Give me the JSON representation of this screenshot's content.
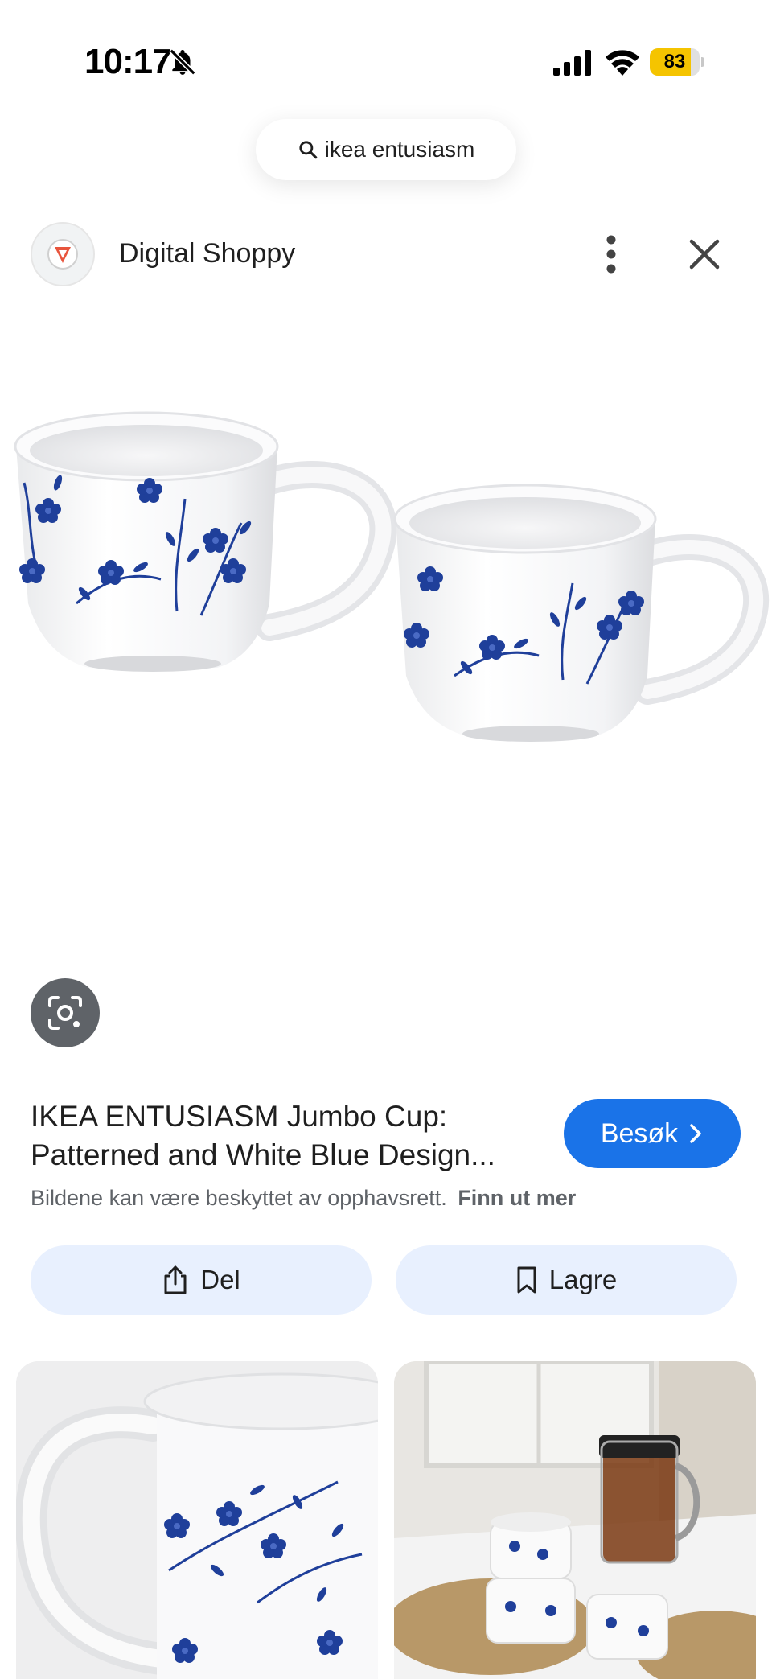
{
  "status_bar": {
    "time": "10:17",
    "battery_level": "83",
    "battery_fraction": 0.83,
    "icons": [
      "bell-off-icon",
      "signal-icon",
      "wifi-icon",
      "battery-icon"
    ]
  },
  "search": {
    "query": "ikea entusiasm",
    "icon": "search-icon"
  },
  "source": {
    "name": "Digital Shoppy",
    "more_icon": "more-vert-icon",
    "close_icon": "close-icon"
  },
  "result": {
    "title_line1": "IKEA ENTUSIASM Jumbo Cup:",
    "title_line2": "Patterned and White Blue Design...",
    "visit_label": "Besøk",
    "copyright_text": "Bildene kan være beskyttet av opphavsrett.",
    "learn_more": "Finn ut mer"
  },
  "actions": {
    "share_label": "Del",
    "save_label": "Lagre"
  },
  "colors": {
    "accent": "#1a73e8",
    "tonal_button": "#e8f0fe",
    "pattern_blue": "#1f3f9a",
    "battery": "#f5c400"
  }
}
